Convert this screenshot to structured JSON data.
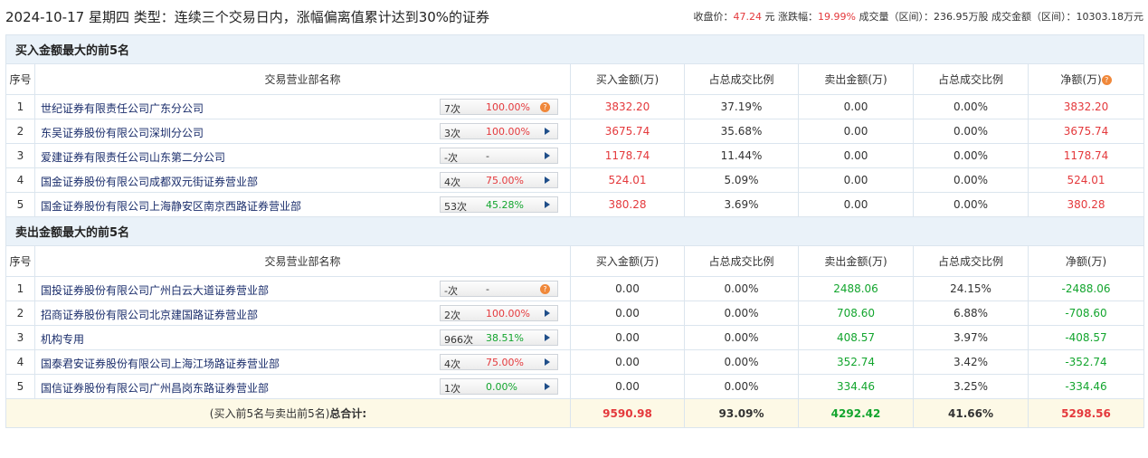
{
  "header": {
    "title": "2024-10-17 星期四 类型：连续三个交易日内，涨幅偏离值累计达到30%的证券",
    "close_label": "收盘价：",
    "close_value": "47.24",
    "close_unit": "元",
    "change_label": "涨跌幅：",
    "change_value": "19.99%",
    "volume_label": "成交量（区间）：",
    "volume_value": "236.95万股",
    "amount_label": "成交金额（区间）：",
    "amount_value": "10303.18万元"
  },
  "columns": {
    "index": "序号",
    "dept": "交易营业部名称",
    "buy": "买入金额(万)",
    "buy_ratio": "占总成交比例",
    "sell": "卖出金额(万)",
    "sell_ratio": "占总成交比例",
    "net": "净额(万)"
  },
  "buy_section": {
    "title": "买入金额最大的前5名",
    "rows": [
      {
        "idx": "1",
        "dept": "世纪证券有限责任公司广东分公司",
        "count": "7次",
        "pct": "100.00%",
        "pct_color": "red",
        "marker": "bubble",
        "buy": "3832.20",
        "buy_ratio": "37.19%",
        "sell": "0.00",
        "sell_ratio": "0.00%",
        "net": "3832.20"
      },
      {
        "idx": "2",
        "dept": "东吴证券股份有限公司深圳分公司",
        "count": "3次",
        "pct": "100.00%",
        "pct_color": "red",
        "marker": "arrow",
        "buy": "3675.74",
        "buy_ratio": "35.68%",
        "sell": "0.00",
        "sell_ratio": "0.00%",
        "net": "3675.74"
      },
      {
        "idx": "3",
        "dept": "爱建证券有限责任公司山东第二分公司",
        "count": "-次",
        "pct": "-",
        "pct_color": "gray",
        "marker": "arrow",
        "buy": "1178.74",
        "buy_ratio": "11.44%",
        "sell": "0.00",
        "sell_ratio": "0.00%",
        "net": "1178.74"
      },
      {
        "idx": "4",
        "dept": "国金证券股份有限公司成都双元街证券营业部",
        "count": "4次",
        "pct": "75.00%",
        "pct_color": "red",
        "marker": "arrow",
        "buy": "524.01",
        "buy_ratio": "5.09%",
        "sell": "0.00",
        "sell_ratio": "0.00%",
        "net": "524.01"
      },
      {
        "idx": "5",
        "dept": "国金证券股份有限公司上海静安区南京西路证券营业部",
        "count": "53次",
        "pct": "45.28%",
        "pct_color": "green",
        "marker": "arrow",
        "buy": "380.28",
        "buy_ratio": "3.69%",
        "sell": "0.00",
        "sell_ratio": "0.00%",
        "net": "380.28"
      }
    ]
  },
  "sell_section": {
    "title": "卖出金额最大的前5名",
    "rows": [
      {
        "idx": "1",
        "dept": "国投证券股份有限公司广州白云大道证券营业部",
        "count": "-次",
        "pct": "-",
        "pct_color": "gray",
        "marker": "bubble",
        "buy": "0.00",
        "buy_ratio": "0.00%",
        "sell": "2488.06",
        "sell_ratio": "24.15%",
        "net": "-2488.06"
      },
      {
        "idx": "2",
        "dept": "招商证券股份有限公司北京建国路证券营业部",
        "count": "2次",
        "pct": "100.00%",
        "pct_color": "red",
        "marker": "arrow",
        "buy": "0.00",
        "buy_ratio": "0.00%",
        "sell": "708.60",
        "sell_ratio": "6.88%",
        "net": "-708.60"
      },
      {
        "idx": "3",
        "dept": "机构专用",
        "count": "966次",
        "pct": "38.51%",
        "pct_color": "green",
        "marker": "arrow",
        "buy": "0.00",
        "buy_ratio": "0.00%",
        "sell": "408.57",
        "sell_ratio": "3.97%",
        "net": "-408.57"
      },
      {
        "idx": "4",
        "dept": "国泰君安证券股份有限公司上海江场路证券营业部",
        "count": "4次",
        "pct": "75.00%",
        "pct_color": "red",
        "marker": "arrow",
        "buy": "0.00",
        "buy_ratio": "0.00%",
        "sell": "352.74",
        "sell_ratio": "3.42%",
        "net": "-352.74"
      },
      {
        "idx": "5",
        "dept": "国信证券股份有限公司广州昌岗东路证券营业部",
        "count": "1次",
        "pct": "0.00%",
        "pct_color": "green",
        "marker": "arrow",
        "buy": "0.00",
        "buy_ratio": "0.00%",
        "sell": "334.46",
        "sell_ratio": "3.25%",
        "net": "-334.46"
      }
    ]
  },
  "total": {
    "label_prefix": "(买入前5名与卖出前5名)",
    "label_bold": "总合计:",
    "buy": "9590.98",
    "buy_ratio": "93.09%",
    "sell": "4292.42",
    "sell_ratio": "41.66%",
    "net": "5298.56"
  },
  "colors": {
    "up": "#e4393c",
    "down": "#13a52e",
    "section_bg": "#eaf2f9",
    "total_bg": "#fdf9e6"
  },
  "icons": {
    "help": "question-circle-icon",
    "expand": "play-arrow-icon",
    "info_bubble": "orange-question-bubble-icon"
  }
}
